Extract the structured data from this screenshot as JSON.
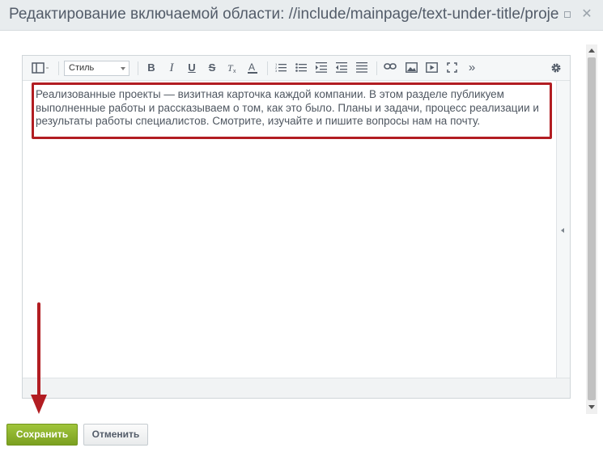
{
  "dialog": {
    "title": "Редактирование включаемой области: //include/mainpage/text-under-title/project-list"
  },
  "toolbar": {
    "style_select_value": "Стиль",
    "more_label": "»",
    "bold_label": "B",
    "italic_label": "I",
    "underline_label": "U",
    "strike_label": "S"
  },
  "editor": {
    "content": "Реализованные проекты — визитная карточка каждой компании. В этом разделе публикуем выполненные работы и рассказываем о том, как это было. Планы и задачи, процесс реализации и результаты работы специалистов. Смотрите, изучайте и пишите вопросы нам на почту."
  },
  "buttons": {
    "save_label": "Сохранить",
    "cancel_label": "Отменить"
  },
  "colors": {
    "save_button": "#8ab12b",
    "annotation": "#b21d22"
  }
}
